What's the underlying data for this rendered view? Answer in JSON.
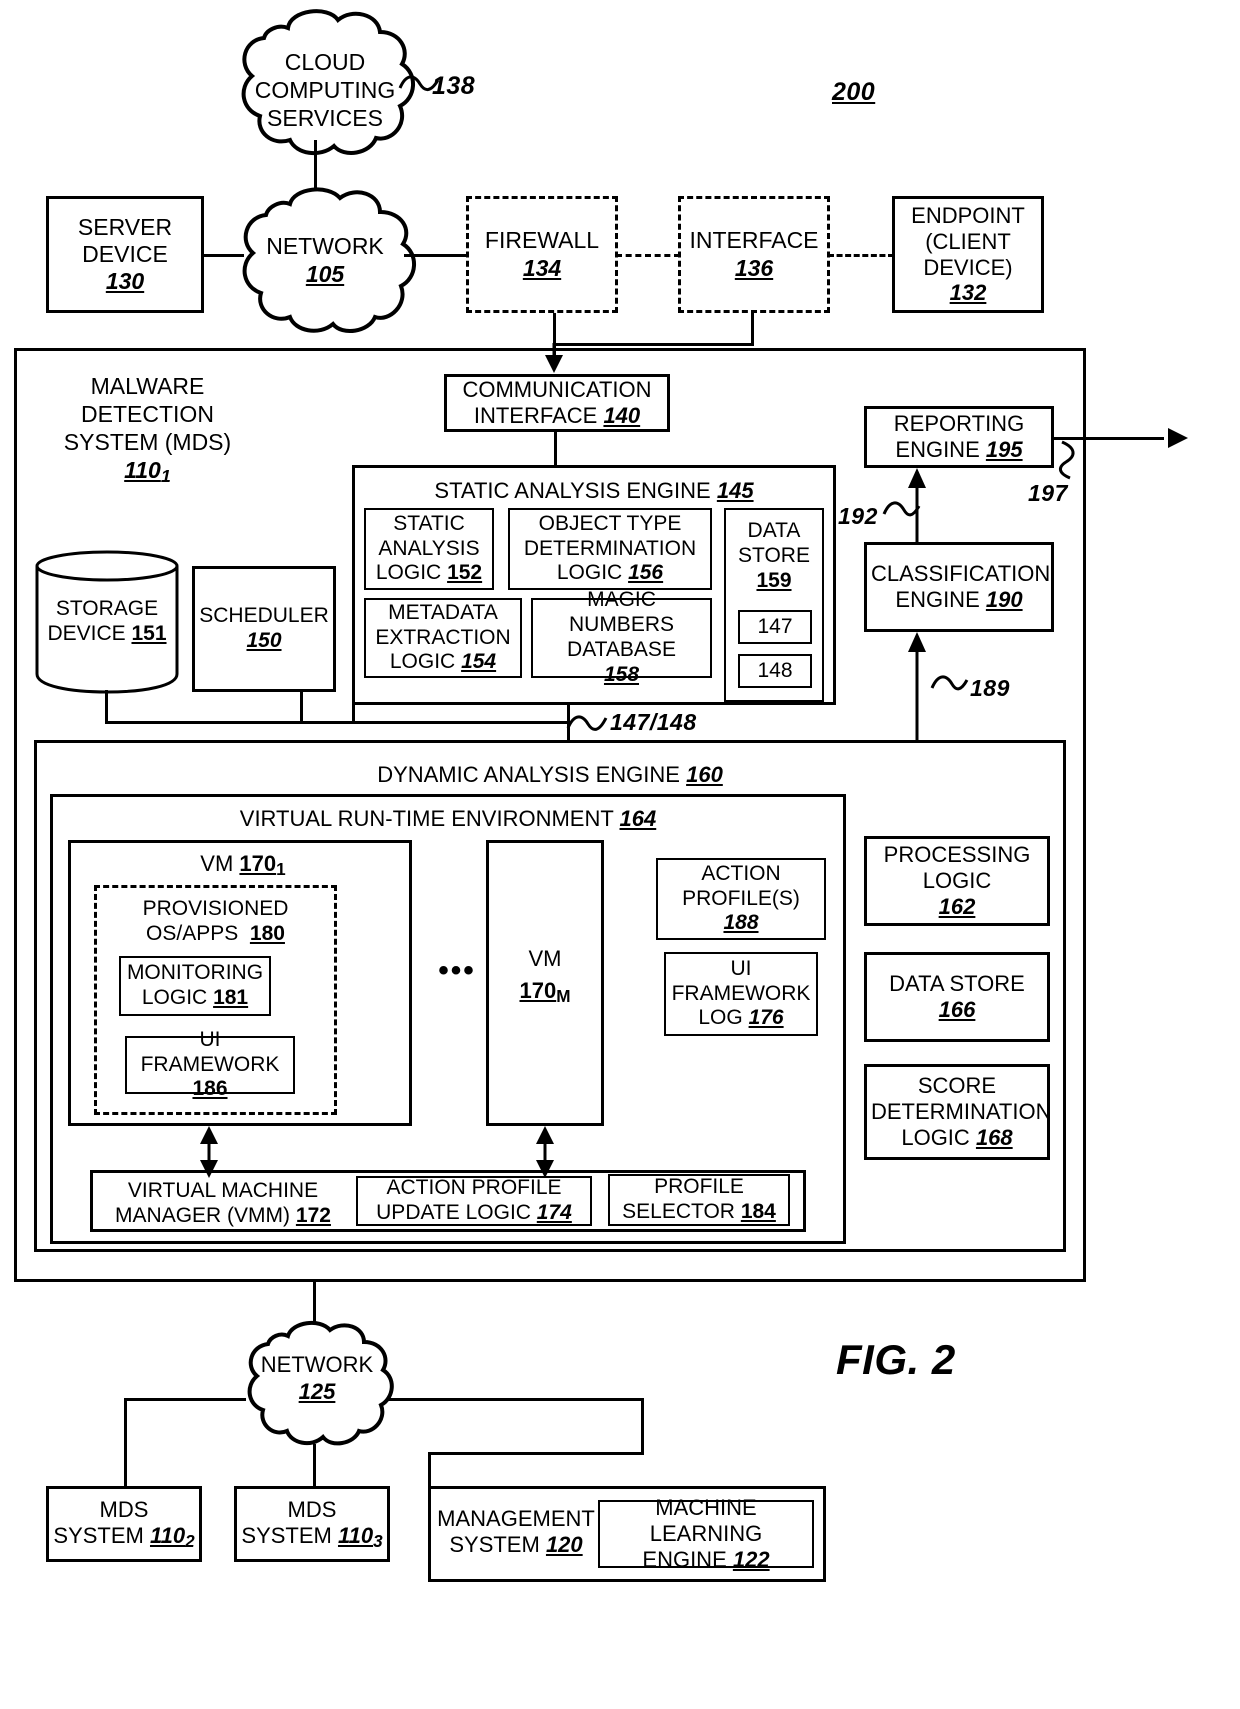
{
  "figure": {
    "label": "FIG. 2",
    "diagram_number": "200"
  },
  "top_network": {
    "cloud_services": {
      "line1": "CLOUD",
      "line2": "COMPUTING",
      "line3": "SERVICES",
      "ref": "138"
    },
    "server_device": {
      "line1": "SERVER",
      "line2": "DEVICE",
      "num": "130"
    },
    "network": {
      "label": "NETWORK",
      "num": "105"
    },
    "firewall": {
      "label": "FIREWALL",
      "num": "134"
    },
    "interface": {
      "label": "INTERFACE",
      "num": "136"
    },
    "endpoint": {
      "line1": "ENDPOINT",
      "line2": "(CLIENT",
      "line3": "DEVICE)",
      "num": "132"
    }
  },
  "mds": {
    "title_line1": "MALWARE",
    "title_line2": "DETECTION",
    "title_line3": "SYSTEM (MDS)",
    "num": "110",
    "num_sub": "1",
    "communication_interface": {
      "line1": "COMMUNICATION",
      "line2": "INTERFACE",
      "num": "140"
    },
    "storage_device": {
      "line1": "STORAGE",
      "line2": "DEVICE",
      "num": "151"
    },
    "scheduler": {
      "label": "SCHEDULER",
      "num": "150"
    },
    "reporting_engine": {
      "line1": "REPORTING",
      "line2": "ENGINE",
      "num": "195"
    },
    "classification_engine": {
      "line1": "CLASSIFICATION",
      "line2": "ENGINE",
      "num": "190"
    },
    "ref_192": "192",
    "ref_189": "189",
    "ref_197": "197",
    "ref_147_148": "147/148"
  },
  "static_analysis": {
    "title": "STATIC ANALYSIS ENGINE",
    "num": "145",
    "static_analysis_logic": {
      "line1": "STATIC",
      "line2": "ANALYSIS",
      "line3": "LOGIC",
      "num": "152"
    },
    "object_type_logic": {
      "line1": "OBJECT TYPE",
      "line2": "DETERMINATION",
      "line3": "LOGIC",
      "num": "156"
    },
    "metadata_logic": {
      "line1": "METADATA",
      "line2": "EXTRACTION",
      "line3": "LOGIC",
      "num": "154"
    },
    "magic_numbers_db": {
      "line1": "MAGIC",
      "line2": "NUMBERS",
      "line3": "DATABASE",
      "num": "158"
    },
    "data_store": {
      "line1": "DATA",
      "line2": "STORE",
      "num": "159",
      "item1": "147",
      "item2": "148"
    }
  },
  "dynamic_analysis": {
    "title": "DYNAMIC ANALYSIS ENGINE",
    "num": "160",
    "vrte": {
      "title": "VIRTUAL RUN-TIME ENVIRONMENT",
      "num": "164"
    },
    "vm1": {
      "label": "VM",
      "num": "170",
      "sub": "1"
    },
    "vmM": {
      "label": "VM",
      "num": "170",
      "sub": "M"
    },
    "ellipsis": "•••",
    "provisioned": {
      "line1": "PROVISIONED",
      "line2": "OS/APPS",
      "num": "180"
    },
    "monitoring_logic": {
      "line1": "MONITORING",
      "line2": "LOGIC",
      "num": "181"
    },
    "ui_framework": {
      "line1": "UI FRAMEWORK",
      "num": "186"
    },
    "action_profiles": {
      "line1": "ACTION",
      "line2": "PROFILE(S)",
      "num": "188"
    },
    "ui_framework_log": {
      "line1": "UI",
      "line2": "FRAMEWORK",
      "line3": "LOG",
      "num": "176"
    },
    "vmm": {
      "line1": "VIRTUAL MACHINE",
      "line2": "MANAGER (VMM)",
      "num": "172"
    },
    "action_profile_update": {
      "line1": "ACTION PROFILE",
      "line2": "UPDATE LOGIC",
      "num": "174"
    },
    "profile_selector": {
      "line1": "PROFILE",
      "line2": "SELECTOR",
      "num": "184"
    },
    "processing_logic": {
      "line1": "PROCESSING",
      "line2": "LOGIC",
      "num": "162"
    },
    "data_store": {
      "line1": "DATA STORE",
      "num": "166"
    },
    "score_logic": {
      "line1": "SCORE",
      "line2": "DETERMINATION",
      "line3": "LOGIC",
      "num": "168"
    }
  },
  "bottom_network": {
    "network": {
      "label": "NETWORK",
      "num": "125"
    },
    "mds2": {
      "line1": "MDS",
      "line2": "SYSTEM",
      "num": "110",
      "sub": "2"
    },
    "mds3": {
      "line1": "MDS",
      "line2": "SYSTEM",
      "num": "110",
      "sub": "3"
    },
    "management_system": {
      "line1": "MANAGEMENT",
      "line2": "SYSTEM",
      "num": "120"
    },
    "ml_engine": {
      "line1": "MACHINE LEARNING",
      "line2": "ENGINE",
      "num": "122"
    }
  }
}
